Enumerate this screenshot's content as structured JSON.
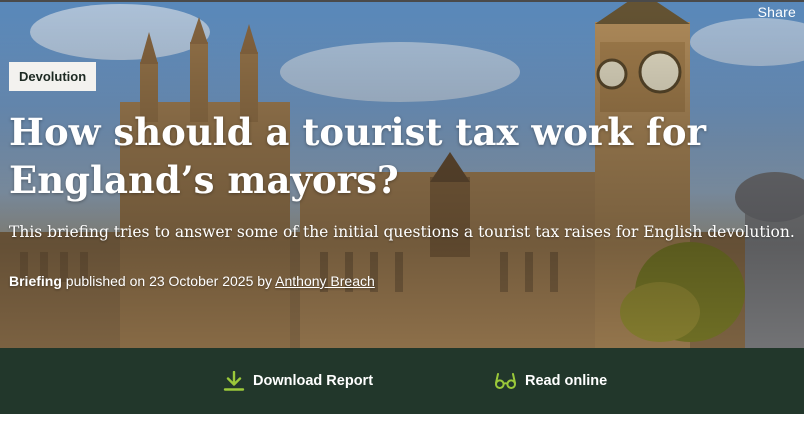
{
  "header": {
    "share_label": "Share"
  },
  "article": {
    "category": "Devolution",
    "title": "How should a tourist tax work for England’s mayors?",
    "subtitle": "This briefing tries to answer some of the initial questions a tourist tax raises for English devolution.",
    "type": "Briefing",
    "published_text": "published on 23 October 2025 by",
    "author": "Anthony Breach"
  },
  "actions": {
    "download_label": "Download Report",
    "read_label": "Read online",
    "icon_download": "download-icon",
    "icon_read": "glasses-icon",
    "accent_color": "#9bc93a"
  },
  "colors": {
    "bar_background": "#22372b",
    "tag_background": "#f3f2ef"
  }
}
